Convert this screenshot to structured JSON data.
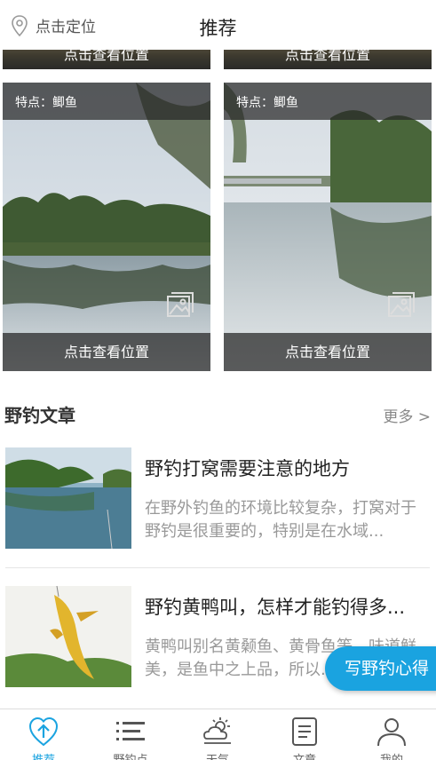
{
  "header": {
    "location_label": "点击定位",
    "title": "推荐"
  },
  "previous_row": {
    "left_caption": "点击查看位置",
    "right_caption": "点击查看位置"
  },
  "spots": [
    {
      "feature": "特点：鲫鱼",
      "caption": "点击查看位置"
    },
    {
      "feature": "特点：鲫鱼",
      "caption": "点击查看位置"
    }
  ],
  "articles_section": {
    "title": "野钓文章",
    "more": "更多 >"
  },
  "articles": [
    {
      "title": "野钓打窝需要注意的地方",
      "summary": "在野外钓鱼的环境比较复杂，打窝对于野钓是很重要的，特别是在水域..."
    },
    {
      "title": "野钓黄鸭叫，怎样才能钓得多...",
      "summary": "黄鸭叫别名黄颡鱼、黄骨鱼等，味道鲜美，是鱼中之上品，所以..."
    }
  ],
  "fab": {
    "label": "写野钓心得"
  },
  "nav": {
    "items": [
      {
        "label": "推荐",
        "icon": "recommend-icon",
        "active": true
      },
      {
        "label": "野钓点",
        "icon": "list-icon",
        "active": false
      },
      {
        "label": "天气",
        "icon": "weather-icon",
        "active": false
      },
      {
        "label": "文章",
        "icon": "article-icon",
        "active": false
      },
      {
        "label": "我的",
        "icon": "profile-icon",
        "active": false
      }
    ]
  },
  "colors": {
    "accent": "#1aa3e0",
    "muted_text": "#999999",
    "overlay": "#282828"
  }
}
